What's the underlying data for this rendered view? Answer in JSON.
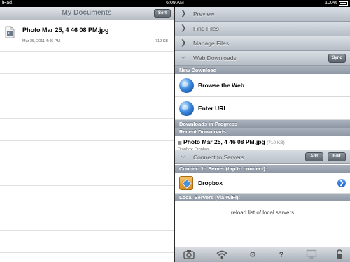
{
  "status": {
    "device": "iPad",
    "time": "6:09 AM",
    "battery": "100%"
  },
  "left": {
    "title": "My Documents",
    "sort_label": "Sort",
    "files": [
      {
        "name": "Photo Mar 25, 4 46 08 PM.jpg",
        "date": "Mar 25, 2011 4:46 PM",
        "size": "710 KB"
      }
    ]
  },
  "right": {
    "sections": {
      "preview": "Preview",
      "find_files": "Find Files",
      "manage_files": "Manage Files",
      "web_downloads": "Web Downloads",
      "connect_servers": "Connect to Servers"
    },
    "sync_label": "Sync",
    "new_download_header": "New Download",
    "browse_web": "Browse the Web",
    "enter_url": "Enter URL",
    "downloads_in_progress": "Downloads in Progress",
    "recent_downloads": "Recent Downloads",
    "recent": {
      "name": "Photo Mar 25, 4 46 08 PM.jpg",
      "size": "(710 KB)",
      "source": "Dropbox: Dropbox"
    },
    "add_label": "Add",
    "edit_label": "Edit",
    "connect_header": "Connect to Server (tap to connect):",
    "dropbox": "Dropbox",
    "local_header": "Local Servers (via WiFi):",
    "reload": "reload list of local servers"
  },
  "toolbar_icons": [
    "camera-icon",
    "wifi-icon",
    "gear-icon",
    "help-icon",
    "monitor-icon",
    "lock-icon"
  ]
}
